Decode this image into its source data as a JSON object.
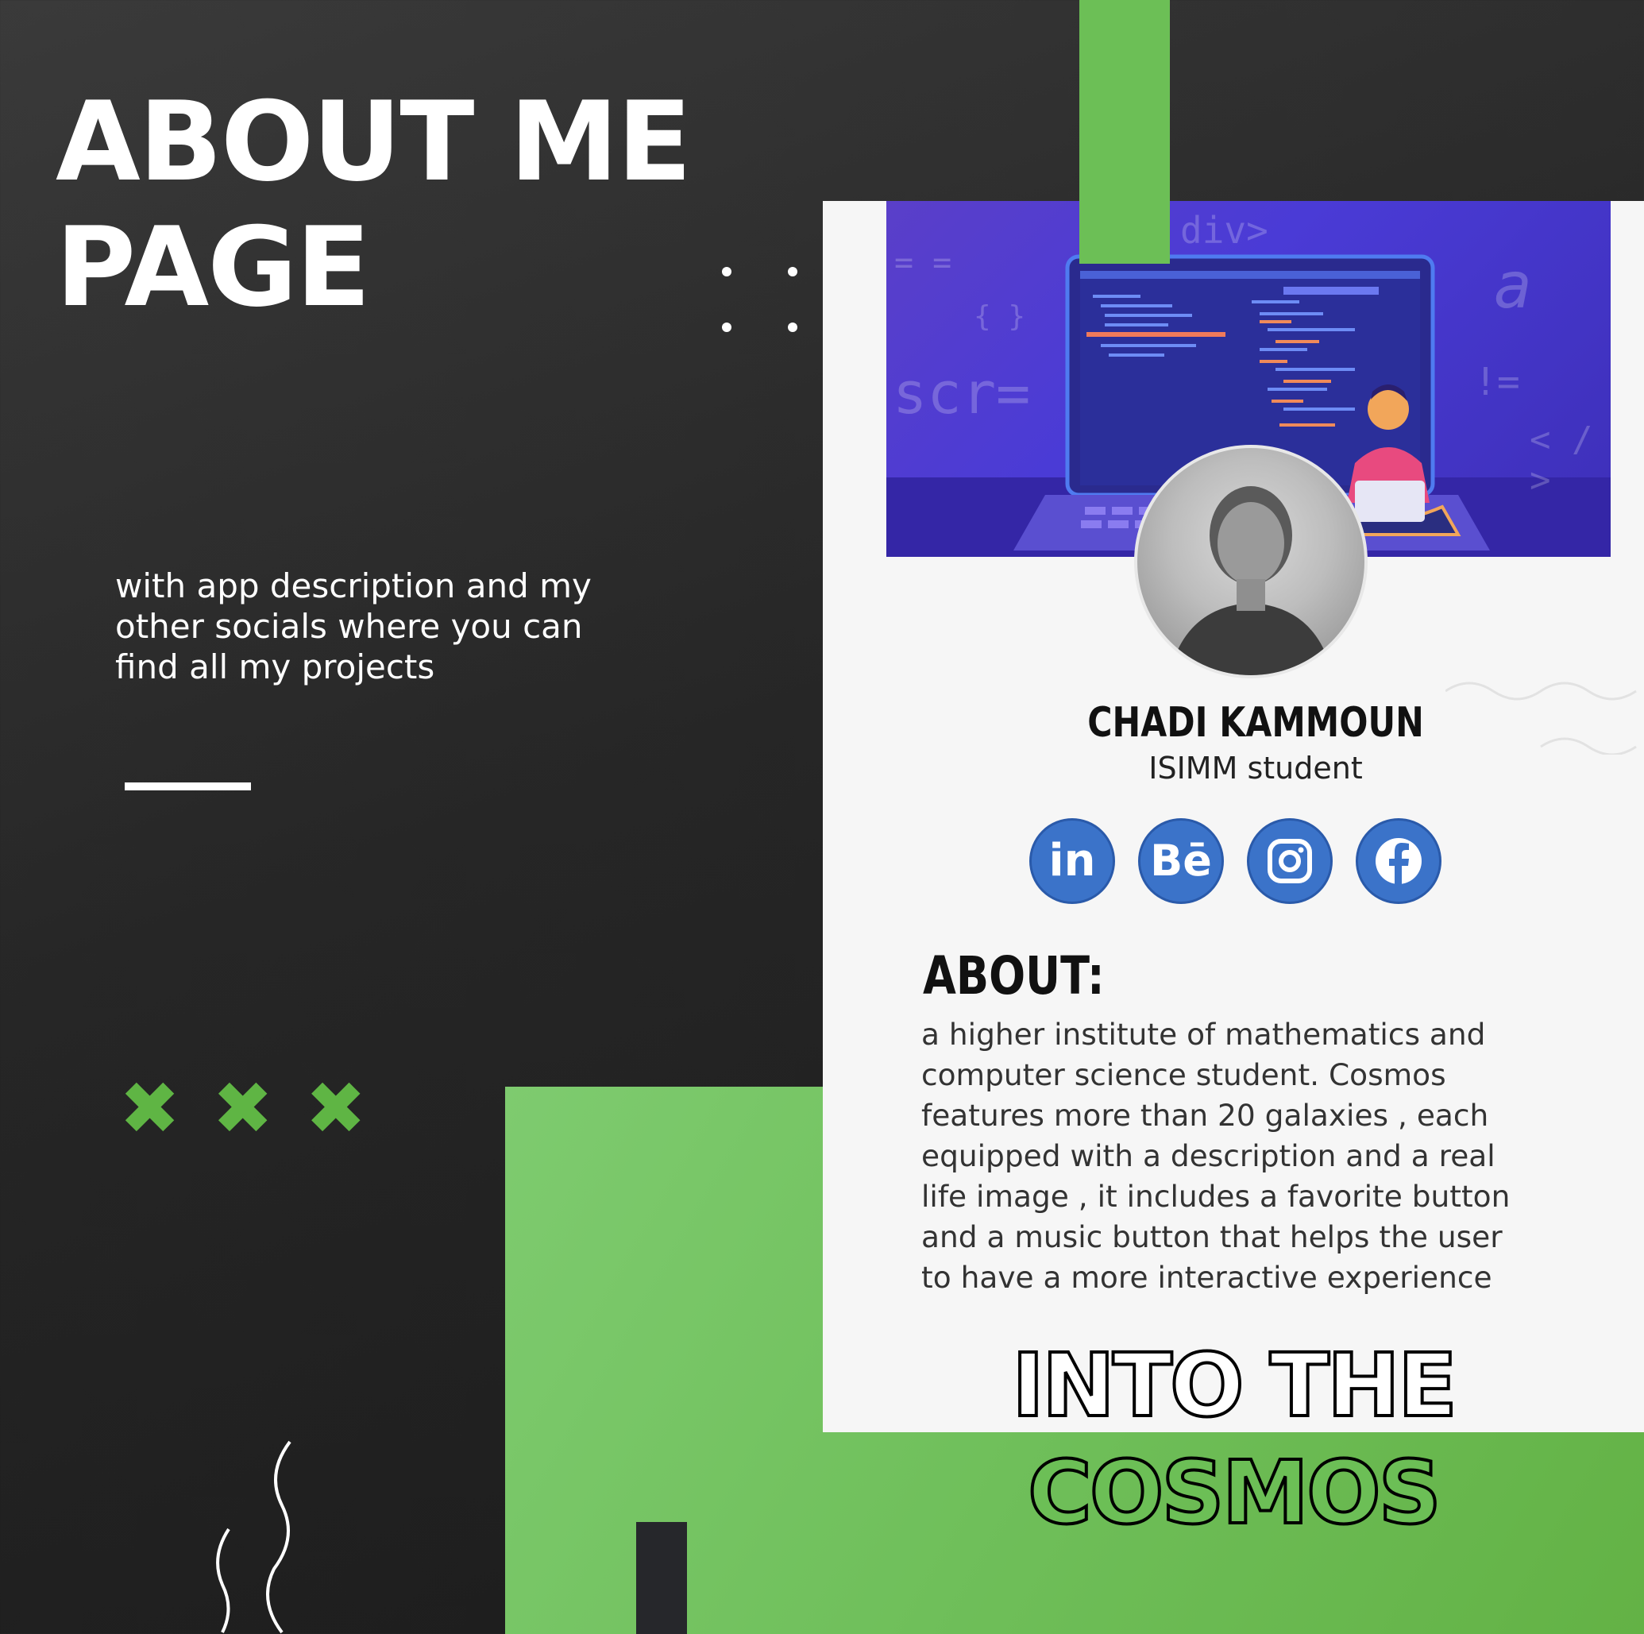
{
  "heading": {
    "line1": "ABOUT ME",
    "line2": "PAGE"
  },
  "subtext": "with app description and my other socials where you can find all my projects",
  "decor": {
    "x_marks": [
      "✖",
      "✖",
      "✖"
    ],
    "accent_color": "#6cbf56"
  },
  "banner": {
    "code_snippets": [
      "div>",
      "scr=",
      "= =",
      "{ }",
      "a",
      "!=",
      "< / >"
    ]
  },
  "profile": {
    "name": "CHADI KAMMOUN",
    "role": "ISIMM student"
  },
  "socials": [
    {
      "icon": "linkedin-icon",
      "label": "in"
    },
    {
      "icon": "behance-icon",
      "label": "Bē"
    },
    {
      "icon": "instagram-icon",
      "label": ""
    },
    {
      "icon": "facebook-icon",
      "label": "f"
    }
  ],
  "about": {
    "title": "ABOUT:",
    "text": "a higher institute of mathematics and\ncomputer science student. Cosmos\nfeatures more than 20 galaxies , each\nequipped with a description and a real\nlife image  , it includes a favorite button\nand a music button that helps the user\nto have a more interactive experience"
  },
  "app_title": {
    "line1": "INTO THE",
    "line2": "COSMOS"
  }
}
